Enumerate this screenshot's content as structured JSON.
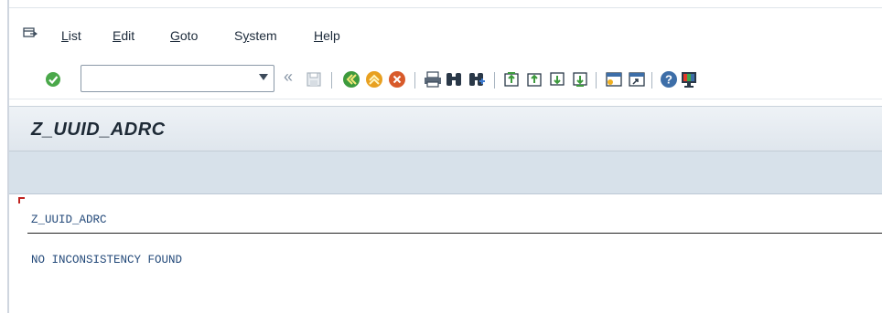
{
  "menu": {
    "items": [
      {
        "label": "List",
        "underline": "L",
        "rest": "ist"
      },
      {
        "label": "Edit",
        "underline": "E",
        "rest": "dit"
      },
      {
        "label": "Goto",
        "underline": "G",
        "rest": "oto"
      },
      {
        "label": "System",
        "underline": "y",
        "pre": "S",
        "rest": "stem"
      },
      {
        "label": "Help",
        "underline": "H",
        "rest": "elp"
      }
    ]
  },
  "toolbar": {
    "command_field_value": "",
    "back_arrows": "«",
    "icons": [
      "enter-icon",
      "save-icon",
      "back-icon",
      "exit-icon",
      "cancel-icon",
      "print-icon",
      "find-icon",
      "find-next-icon",
      "first-page-icon",
      "previous-page-icon",
      "next-page-icon",
      "last-page-icon",
      "create-session-icon",
      "shortcut-icon",
      "help-icon",
      "customize-layout-icon"
    ]
  },
  "screen": {
    "title": "Z_UUID_ADRC"
  },
  "list": {
    "header": "Z_UUID_ADRC",
    "message": "NO INCONSISTENCY FOUND"
  },
  "colors": {
    "accent_red": "#c0231f",
    "text_blue": "#244a7a",
    "enter_green": "#4aa84a",
    "back_green": "#3d9a3d",
    "exit_orange": "#e8a020",
    "cancel_red": "#d85a2a"
  }
}
